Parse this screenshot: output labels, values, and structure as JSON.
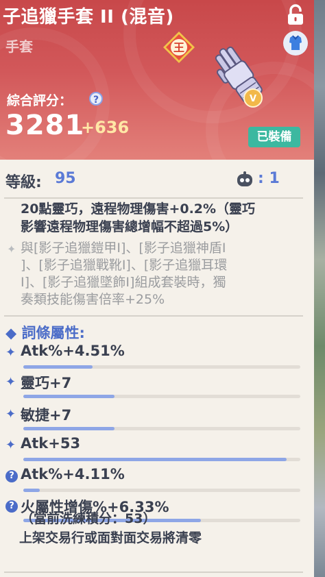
{
  "header": {
    "title": "子追獵手套 II (混音)",
    "subtype": "手套",
    "score_label": "綜合評分：",
    "score": "3281",
    "score_delta": "+636",
    "equipped_label": "已裝備",
    "icons": [
      "lock-icon",
      "armor-icon",
      "king-badge-icon",
      "gauntlet-icon",
      "gold-badge-icon",
      "help-icon"
    ]
  },
  "level": {
    "label": "等級:",
    "value": "95",
    "count": ": 1"
  },
  "effects": {
    "effect1_line1": "20點靈巧，遠程物理傷害+0.2%（靈巧",
    "effect1_line2": "影響遠程物理傷害總增幅不超過5%）",
    "effect2_line1": "與[影子追獵鎧甲Ⅰ]、[影子追獵神盾Ⅰ",
    "effect2_line2": "]、[影子追獵戰靴Ⅰ]、[影子追獵耳環",
    "effect2_line3": "Ⅰ]、[影子追獵墜飾Ⅰ]組成套裝時，獨",
    "effect2_line4": "奏類技能傷害倍率+25%"
  },
  "attributes": {
    "title": "◆ 詞條屬性:",
    "items": [
      {
        "text": "Atk%+4.51%",
        "fill": 0.25,
        "icon": "sparkle"
      },
      {
        "text": "靈巧+7",
        "fill": 0.33,
        "icon": "sparkle"
      },
      {
        "text": "敏捷+7",
        "fill": 0.33,
        "icon": "sparkle"
      },
      {
        "text": "Atk+53",
        "fill": 0.95,
        "icon": "sparkle"
      },
      {
        "text": "Atk%+4.11%",
        "fill": 0.06,
        "icon": "question"
      },
      {
        "text": "火屬性增傷%+6.33%",
        "fill": 0.64,
        "icon": "question"
      }
    ]
  },
  "footer": {
    "line1": "（當前洗練積分：53）",
    "line2": "上架交易行或面對面交易將清零"
  },
  "colors": {
    "header_red": "#c8484a",
    "accent_blue": "#5b7ad6",
    "equipped_green": "#3cb8a0",
    "bar_fill": "#8ea6e6"
  }
}
